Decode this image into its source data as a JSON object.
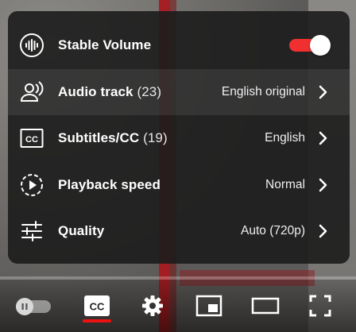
{
  "settings_menu": {
    "items": [
      {
        "label": "Stable Volume",
        "count": "",
        "value": "",
        "type": "toggle",
        "icon": "stable-volume-icon",
        "on": true
      },
      {
        "label": "Audio track",
        "count": "(23)",
        "value": "English original",
        "type": "submenu",
        "icon": "audio-track-icon"
      },
      {
        "label": "Subtitles/CC",
        "count": "(19)",
        "value": "English",
        "type": "submenu",
        "icon": "subtitles-icon"
      },
      {
        "label": "Playback speed",
        "count": "",
        "value": "Normal",
        "type": "submenu",
        "icon": "playback-speed-icon"
      },
      {
        "label": "Quality",
        "count": "",
        "value": "Auto (720p)",
        "type": "submenu",
        "icon": "quality-icon"
      }
    ]
  },
  "controls": {
    "autoplay_icon": "pause-icon",
    "cc_icon": "subtitles-cc-icon",
    "settings_icon": "gear-icon",
    "miniplayer_icon": "miniplayer-icon",
    "theater_icon": "theater-mode-icon",
    "fullscreen_icon": "fullscreen-icon",
    "accent_color": "#ff0000"
  }
}
